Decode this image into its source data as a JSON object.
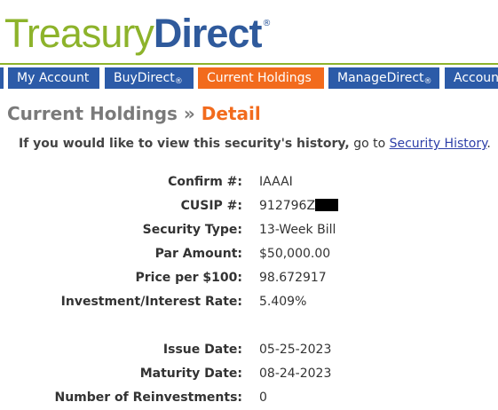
{
  "logo": {
    "part1": "Treasury",
    "part2": "Direct",
    "reg": "®"
  },
  "nav": {
    "tabs": [
      {
        "label": "My Account",
        "reg": ""
      },
      {
        "label": "BuyDirect",
        "reg": "®"
      },
      {
        "label": "Current Holdings",
        "reg": ""
      },
      {
        "label": "ManageDirect",
        "reg": "®"
      },
      {
        "label": "Accoun",
        "reg": ""
      }
    ],
    "active_color": "#f26b1d",
    "tab_color": "#2c5ba8"
  },
  "page": {
    "breadcrumb": "Current Holdings",
    "separator": "»",
    "title": "Detail"
  },
  "intro": {
    "question": "If you would like to view this security's history,",
    "goto": "go to",
    "link": "Security History",
    "end": "."
  },
  "details": {
    "confirm_label": "Confirm #:",
    "confirm_value": "IAAAI",
    "cusip_label": "CUSIP #:",
    "cusip_value": "912796Z",
    "type_label": "Security Type:",
    "type_value": "13-Week Bill",
    "par_label": "Par Amount:",
    "par_value": "$50,000.00",
    "price_label": "Price per $100:",
    "price_value": "98.672917",
    "rate_label": "Investment/Interest Rate:",
    "rate_value": "5.409%",
    "issue_label": "Issue Date:",
    "issue_value": "05-25-2023",
    "maturity_label": "Maturity Date:",
    "maturity_value": "08-24-2023",
    "reinvest_label": "Number of Reinvestments:",
    "reinvest_value": "0"
  }
}
